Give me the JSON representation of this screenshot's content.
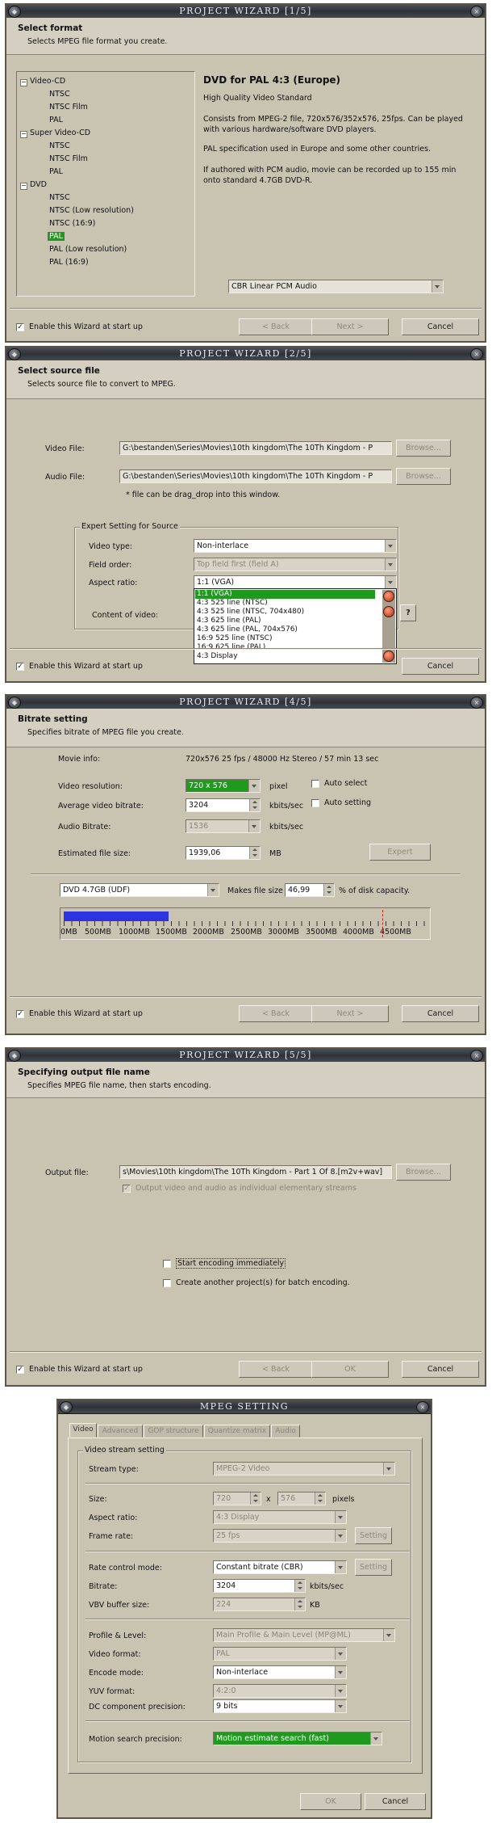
{
  "w1": {
    "title": "PROJECT WIZARD [1/5]",
    "heading": "Select format",
    "subheading": "Selects MPEG file format you create.",
    "tree": {
      "videocd": "Video-CD",
      "vcd_ntsc": "NTSC",
      "vcd_ntscfilm": "NTSC Film",
      "vcd_pal": "PAL",
      "svcd": "Super Video-CD",
      "svcd_ntsc": "NTSC",
      "svcd_ntscfilm": "NTSC Film",
      "svcd_pal": "PAL",
      "dvd": "DVD",
      "dvd_ntsc": "NTSC",
      "dvd_ntsc_low": "NTSC (Low resolution)",
      "dvd_ntsc169": "NTSC (16:9)",
      "dvd_pal": "PAL",
      "dvd_pal_low": "PAL (Low resolution)",
      "dvd_pal169": "PAL (16:9)"
    },
    "desc_title": "DVD for PAL 4:3 (Europe)",
    "desc_quality": "High Quality Video Standard",
    "desc_p1": "Consists from MPEG-2 file, 720x576/352x576, 25fps. Can be played with various hardware/software DVD players.",
    "desc_p2": "PAL specification used in Europe and some other countries.",
    "desc_p3": "If authored with PCM audio, movie can be recorded up to 155 min onto standard 4.7GB DVD-R.",
    "audio_combo": "CBR   Linear PCM Audio",
    "enable_wizard": "Enable this Wizard at start up",
    "back": "< Back",
    "next": "Next >",
    "cancel": "Cancel"
  },
  "w2": {
    "title": "PROJECT WIZARD [2/5]",
    "heading": "Select source file",
    "subheading": "Selects source file to convert to MPEG.",
    "video_label": "Video File:",
    "video_value": "G:\\bestanden\\Series\\Movies\\10th kingdom\\The 10Th Kingdom - P",
    "audio_label": "Audio File:",
    "audio_value": "G:\\bestanden\\Series\\Movies\\10th kingdom\\The 10Th Kingdom - P",
    "browse": "Browse...",
    "drag_note": "* file can be drag_drop into this window.",
    "expert_group": "Expert Setting for Source",
    "video_type_label": "Video type:",
    "video_type_value": "Non-interlace",
    "field_order_label": "Field order:",
    "field_order_value": "Top field first (field A)",
    "aspect_label": "Aspect ratio:",
    "aspect_value": "1:1 (VGA)",
    "content_label": "Content of video:",
    "help": "?",
    "aspect_options": [
      "1:1 (VGA)",
      "4:3 525 line (NTSC)",
      "4:3 525 line (NTSC, 704x480)",
      "4:3 625 line (PAL)",
      "4:3 625 line (PAL, 704x576)",
      "16:9 525 line (NTSC)",
      "16:9 625 line (PAL)",
      "4:3 Display"
    ],
    "enable_wizard": "Enable this Wizard at start up",
    "cancel": "Cancel"
  },
  "w4": {
    "title": "PROJECT WIZARD [4/5]",
    "heading": "Bitrate setting",
    "subheading": "Specifies bitrate of MPEG file you create.",
    "movie_info_label": "Movie info:",
    "movie_info_value": "720x576 25 fps / 48000 Hz Stereo / 57 min 13 sec",
    "video_res_label": "Video resolution:",
    "video_res_value": "720 x 576",
    "pixel": "pixel",
    "auto_select": "Auto select",
    "avg_bitrate_label": "Average video bitrate:",
    "avg_bitrate_value": "3204",
    "kbits": "kbits/sec",
    "auto_setting": "Auto setting",
    "audio_bitrate_label": "Audio Bitrate:",
    "audio_bitrate_value": "1536",
    "kbits2": "kbits/sec",
    "est_size_label": "Estimated file size:",
    "est_size_value": "1939,06",
    "mb": "MB",
    "expert": "Expert",
    "disc_value": "DVD 4.7GB (UDF)",
    "makes_size": "Makes file size",
    "percent_value": "46,99",
    "percent_label": "% of disk capacity.",
    "gauge_fill": 0.4699,
    "scale_labels": [
      "0MB",
      "500MB",
      "1000MB",
      "1500MB",
      "2000MB",
      "2500MB",
      "3000MB",
      "3500MB",
      "4000MB",
      "4500MB"
    ],
    "enable_wizard": "Enable this Wizard at start up",
    "back": "< Back",
    "next": "Next >",
    "cancel": "Cancel"
  },
  "w5": {
    "title": "PROJECT WIZARD [5/5]",
    "heading": "Specifying output file name",
    "subheading": "Specifies MPEG file name, then starts encoding.",
    "output_label": "Output file:",
    "output_value": "s\\Movies\\10th kingdom\\The 10Th Kingdom - Part 1 Of 8.[m2v+wav]",
    "browse": "Browse...",
    "elementary": "Output video and audio as individual elementary streams",
    "start_encoding": "Start encoding immediately",
    "batch": "Create another project(s) for batch encoding.",
    "enable_wizard": "Enable this Wizard at start up",
    "back": "< Back",
    "ok": "OK",
    "cancel": "Cancel"
  },
  "ms": {
    "title": "MPEG SETTING",
    "tabs": [
      "Video",
      "Advanced",
      "GOP structure",
      "Quantize matrix",
      "Audio"
    ],
    "group": "Video stream setting",
    "stream_type_label": "Stream type:",
    "stream_type_value": "MPEG-2 Video",
    "size_label": "Size:",
    "size_w": "720",
    "size_x": "x",
    "size_h": "576",
    "pixels": "pixels",
    "aspect_label": "Aspect ratio:",
    "aspect_value": "4:3 Display",
    "frame_rate_label": "Frame rate:",
    "frame_rate_value": "25 fps",
    "setting": "Setting",
    "rate_mode_label": "Rate control mode:",
    "rate_mode_value": "Constant bitrate (CBR)",
    "bitrate_label": "Bitrate:",
    "bitrate_value": "3204",
    "kbits": "kbits/sec",
    "vbv_label": "VBV buffer size:",
    "vbv_value": "224",
    "kb": "KB",
    "profile_label": "Profile & Level:",
    "profile_value": "Main Profile & Main Level (MP@ML)",
    "video_format_label": "Video format:",
    "video_format_value": "PAL",
    "encode_mode_label": "Encode mode:",
    "encode_mode_value": "Non-interlace",
    "yuv_label": "YUV format:",
    "yuv_value": "4:2:0",
    "dc_label": "DC component precision:",
    "dc_value": "9 bits",
    "motion_label": "Motion search precision:",
    "motion_value": "Motion estimate search (fast)",
    "ok": "OK",
    "cancel": "Cancel"
  }
}
